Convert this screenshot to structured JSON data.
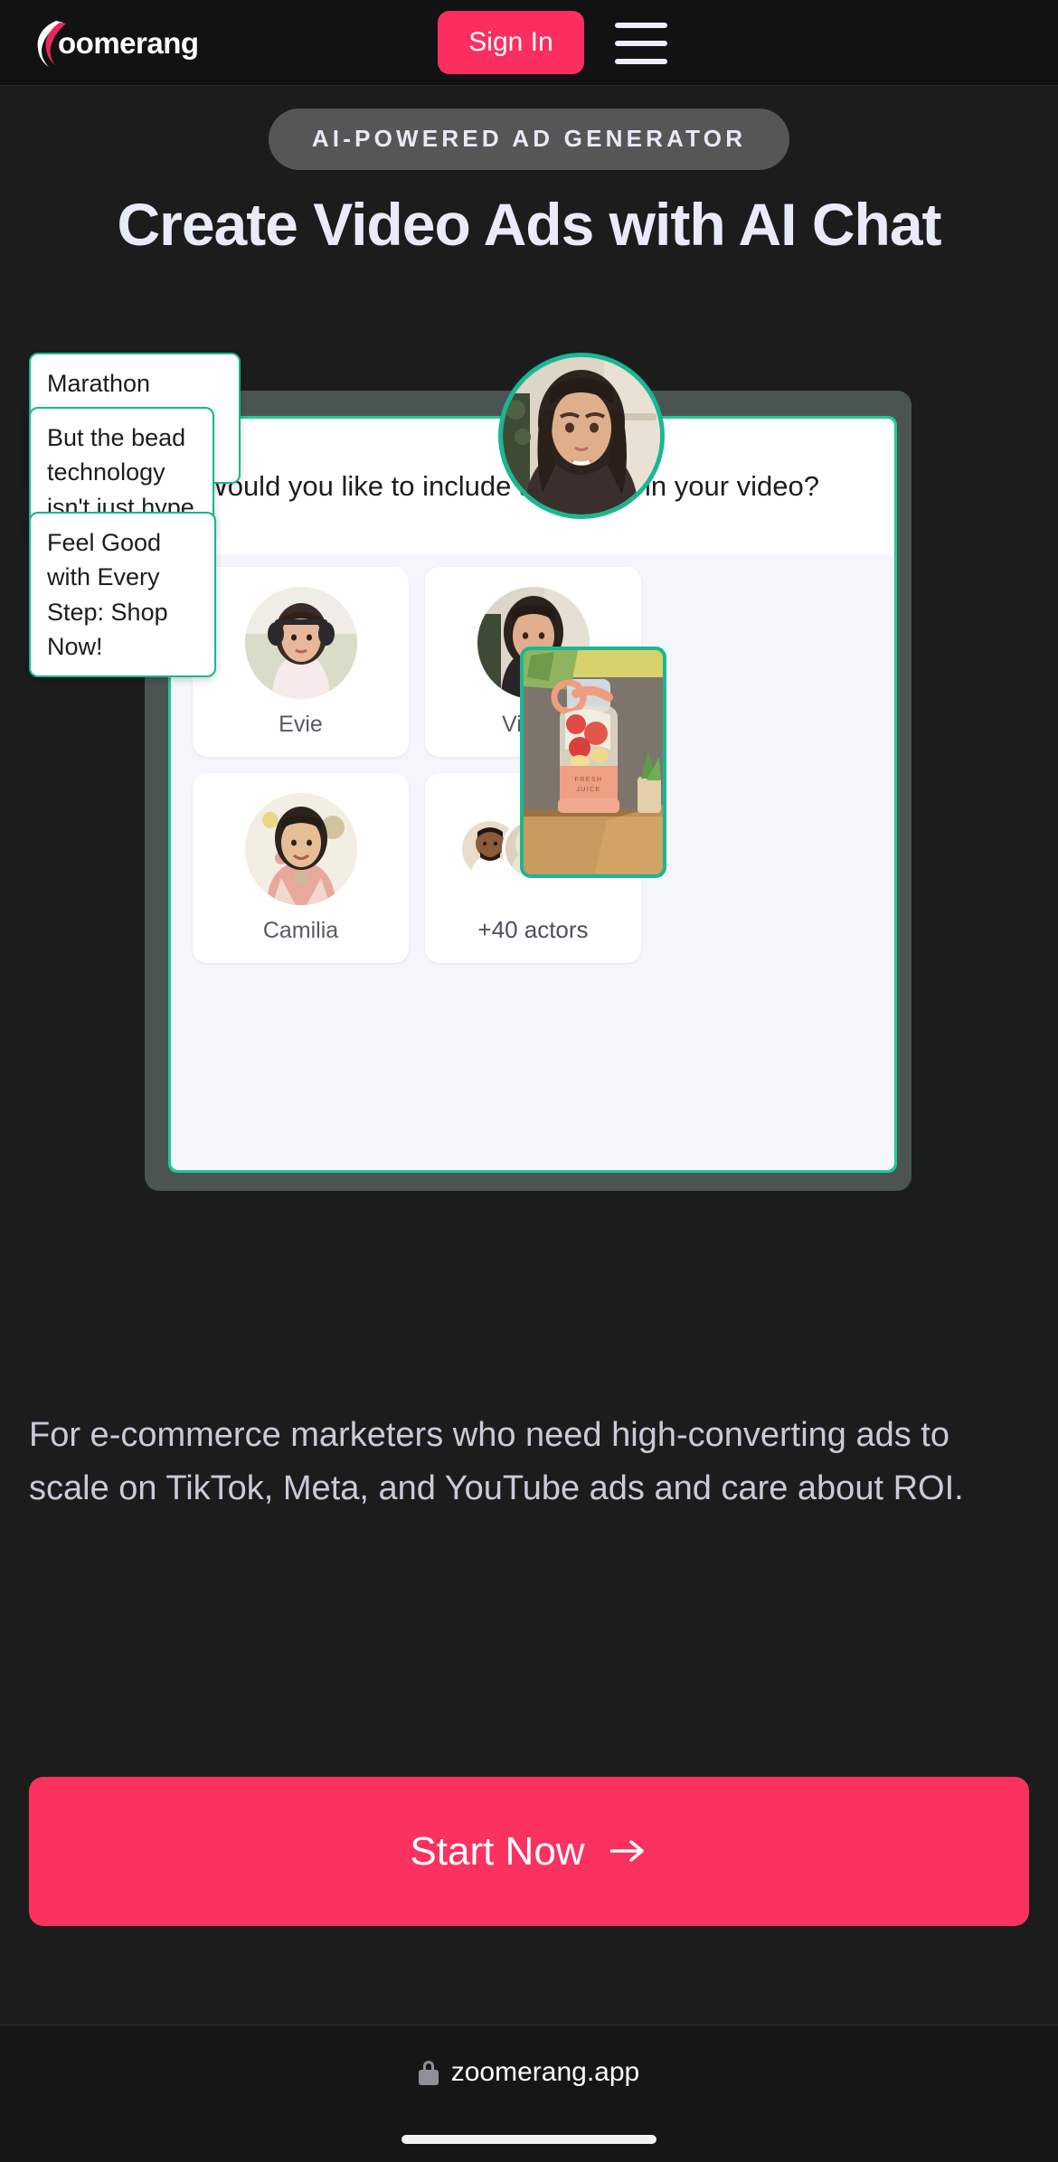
{
  "header": {
    "logo_text": "oomerang",
    "logo_icon": "boomerang-swoosh-icon",
    "sign_in_label": "Sign In",
    "menu_icon": "hamburger-menu-icon"
  },
  "hero": {
    "badge": "AI-POWERED AD GENERATOR",
    "headline": "Create Video Ads with AI Chat",
    "subtext": "For e-commerce marketers who need high-converting ads to scale on TikTok, Meta, and YouTube ads and care about ROI.",
    "cta_label": "Start Now",
    "cta_icon": "arrow-right-icon"
  },
  "mockup": {
    "chat_question": "Would you like to include an Avatar in your video?",
    "bubbles": [
      {
        "text": "Marathon training is brutal..."
      },
      {
        "text": "But the bead technology isn't just hype"
      },
      {
        "text": "Feel Good with Every Step: Shop Now!"
      }
    ],
    "avatars": [
      {
        "name": "Evie"
      },
      {
        "name": "Vilena"
      },
      {
        "name": "Camilia"
      }
    ],
    "more_actors_label": "+40 actors",
    "product_label": "FRESH JUICE",
    "head_avatar_name": "Vilena"
  },
  "browser": {
    "url": "zoomerang.app",
    "lock_icon": "lock-icon"
  },
  "colors": {
    "accent_pink": "#fb2e5f",
    "accent_teal": "#17b892",
    "bg_dark": "#1c1c1c",
    "header_dark": "#121212",
    "badge_gray": "#565656",
    "text_light": "#e9ebfa",
    "text_muted": "#c9ccd8"
  }
}
